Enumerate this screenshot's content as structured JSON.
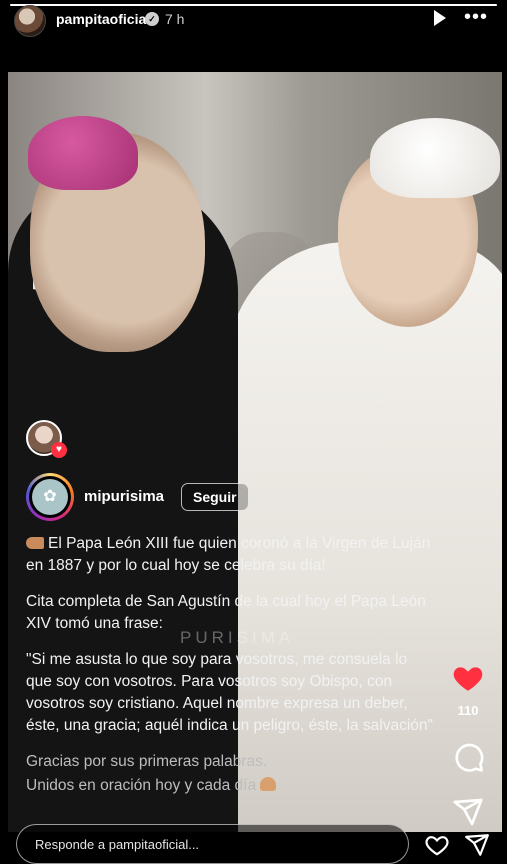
{
  "header": {
    "username": "pampitaoficial",
    "time": "7 h",
    "progress": 1.0
  },
  "story": {
    "account": {
      "name": "mipurisima",
      "follow_label": "Seguir"
    },
    "watermark": "PURISIMA",
    "caption": {
      "p1": "El Papa León XIII fue quien coronó a la Virgen de Luján en 1887 y por lo cual hoy se celebra su día!",
      "p2": "Cita completa de San Agustín de la cual hoy el Papa León XIV tomó una frase:",
      "p3": "\"Si me asusta lo que soy para vosotros, me consuela lo que soy con vosotros. Para vosotros soy Obispo, con vosotros soy cristiano. Aquel nombre expresa un deber, éste, una gracia; aquél indica un peligro, éste, la salvación\"",
      "p4": "Gracias por sus primeras palabras.",
      "p5": "Unidos en oración hoy y cada día"
    }
  },
  "actions": {
    "like_count": "110",
    "like_color": "#ff3040"
  },
  "reply": {
    "placeholder": "Responde a pampitaoficial..."
  },
  "icons": [
    "verified-icon",
    "play-icon",
    "more-icon",
    "heart-icon",
    "comment-icon",
    "share-icon",
    "pointing-hand-emoji",
    "praying-hands-emoji"
  ]
}
